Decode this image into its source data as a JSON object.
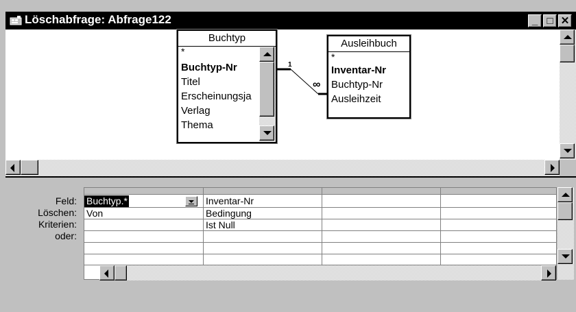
{
  "window": {
    "title": "Löschabfrage: Abfrage122",
    "minimize_glyph": "_",
    "maximize_glyph": "□",
    "close_glyph": "✕"
  },
  "tables": [
    {
      "name": "Buchtyp",
      "fields": [
        {
          "label": "*",
          "key": false
        },
        {
          "label": "Buchtyp-Nr",
          "key": true
        },
        {
          "label": "Titel",
          "key": false
        },
        {
          "label": "Erscheinungsja",
          "key": false
        },
        {
          "label": "Verlag",
          "key": false
        },
        {
          "label": "Thema",
          "key": false
        }
      ]
    },
    {
      "name": "Ausleihbuch",
      "fields": [
        {
          "label": "*",
          "key": false
        },
        {
          "label": "Inventar-Nr",
          "key": true
        },
        {
          "label": "Buchtyp-Nr",
          "key": false
        },
        {
          "label": "Ausleihzeit",
          "key": false
        }
      ]
    }
  ],
  "relationship": {
    "one_label": "1",
    "many_label": "∞"
  },
  "grid": {
    "row_labels": [
      "Feld:",
      "Löschen:",
      "Kriterien:",
      "oder:"
    ],
    "columns": [
      {
        "feld": "Buchtyp.*",
        "loeschen": "Von",
        "kriterien": "",
        "oder": ""
      },
      {
        "feld": "Inventar-Nr",
        "loeschen": "Bedingung",
        "kriterien": "Ist Null",
        "oder": ""
      },
      {
        "feld": "",
        "loeschen": "",
        "kriterien": "",
        "oder": ""
      },
      {
        "feld": "",
        "loeschen": "",
        "kriterien": "",
        "oder": ""
      }
    ]
  },
  "colors": {
    "titlebar": "#000000",
    "face": "#c0c0c0",
    "selection": "#000000"
  }
}
